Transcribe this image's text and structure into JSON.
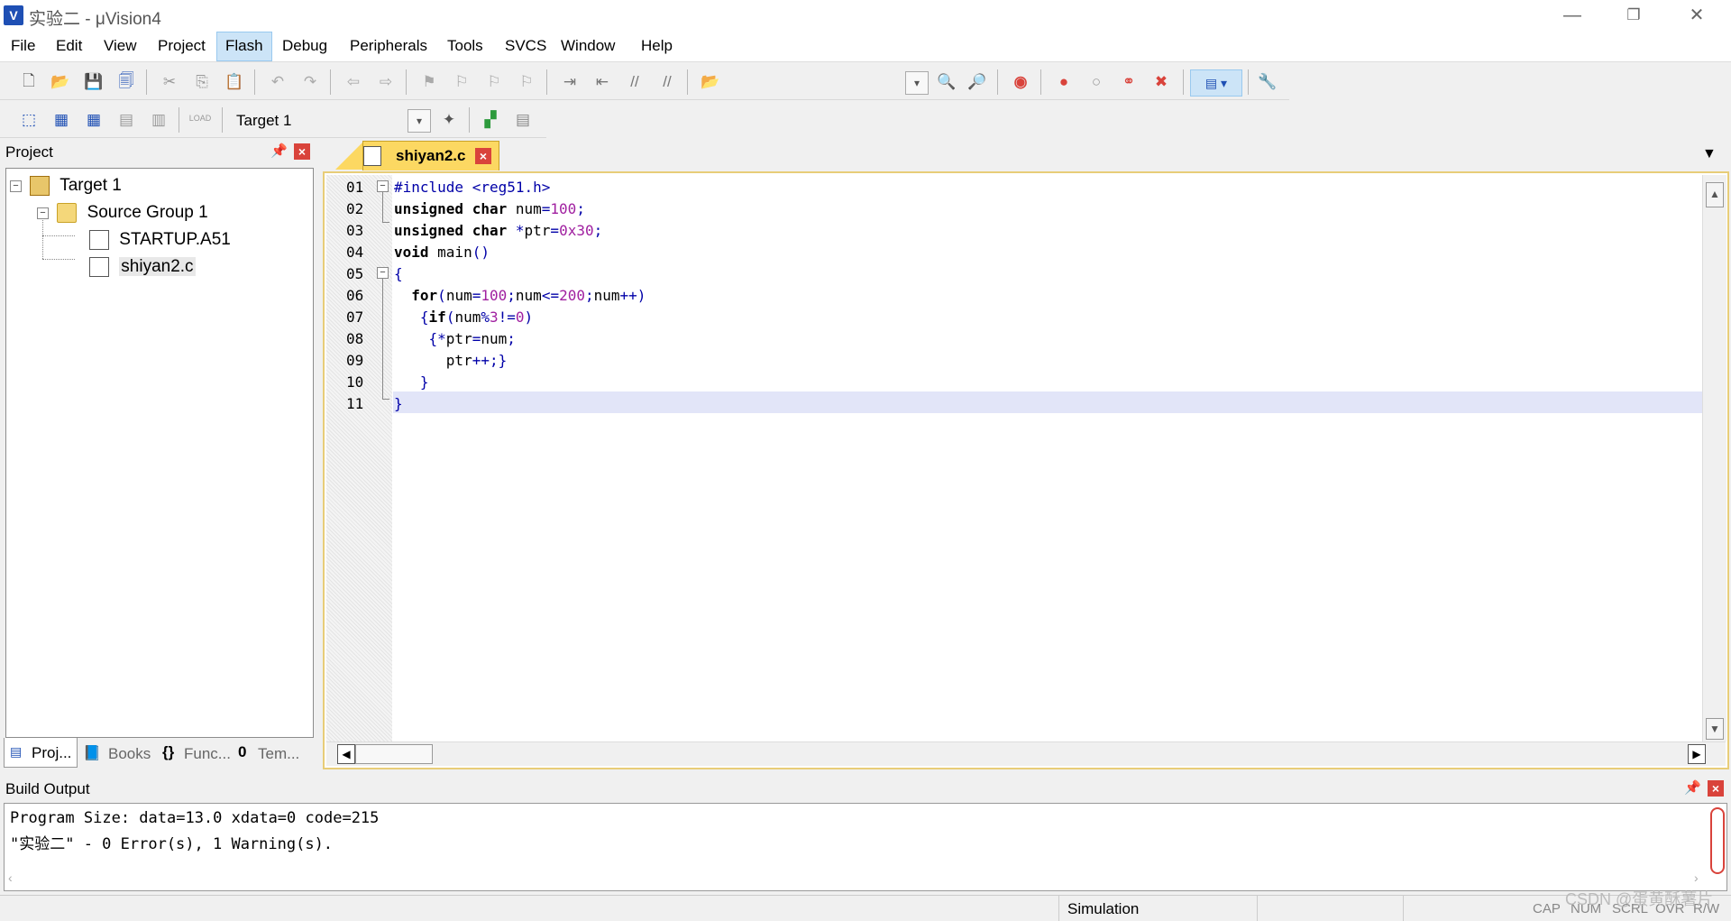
{
  "window": {
    "title": "实验二 - μVision4",
    "icon_label": "V"
  },
  "menu": [
    {
      "label": "File"
    },
    {
      "label": "Edit"
    },
    {
      "label": "View"
    },
    {
      "label": "Project"
    },
    {
      "label": "Flash"
    },
    {
      "label": "Debug"
    },
    {
      "label": "Peripherals"
    },
    {
      "label": "Tools"
    },
    {
      "label": "SVCS"
    },
    {
      "label": "Window"
    },
    {
      "label": "Help"
    }
  ],
  "build_toolbar": {
    "target_select": "Target 1",
    "load_icon_text": "LOAD"
  },
  "project_panel": {
    "title": "Project",
    "tree": [
      {
        "label": "Target 1",
        "icon": "target-icon"
      },
      {
        "label": "Source Group 1",
        "icon": "folder-icon"
      },
      {
        "label": "STARTUP.A51",
        "icon": "file-icon"
      },
      {
        "label": "shiyan2.c",
        "icon": "file-icon"
      }
    ],
    "tabs": [
      {
        "label": "Proj...",
        "icon": "project-icon"
      },
      {
        "label": "Books",
        "icon": "books-icon"
      },
      {
        "label": "Func...",
        "icon": "functions-icon"
      },
      {
        "label": "Tem...",
        "icon": "templates-icon"
      }
    ],
    "tab_icon_glyphs": [
      "{}",
      "0"
    ]
  },
  "editor": {
    "tab": "shiyan2.c",
    "line_numbers": [
      "01",
      "02",
      "03",
      "04",
      "05",
      "06",
      "07",
      "08",
      "09",
      "10",
      "11"
    ],
    "current_line": 11
  },
  "build_output": {
    "title": "Build Output",
    "lines": [
      "Program Size: data=13.0 xdata=0 code=215",
      "\"实验二\" - 0 Error(s), 1 Warning(s)."
    ]
  },
  "statusbar": {
    "mode": "Simulation",
    "indicators": [
      "CAP",
      "NUM",
      "SCRL",
      "OVR",
      "R/W"
    ],
    "watermark": "CSDN @蛋黄酥薯片"
  },
  "colors": {
    "active_tab": "#fcd862",
    "current_line": "#e2e5f8",
    "close_red": "#d9433b",
    "number_purple": "#a020a0"
  }
}
